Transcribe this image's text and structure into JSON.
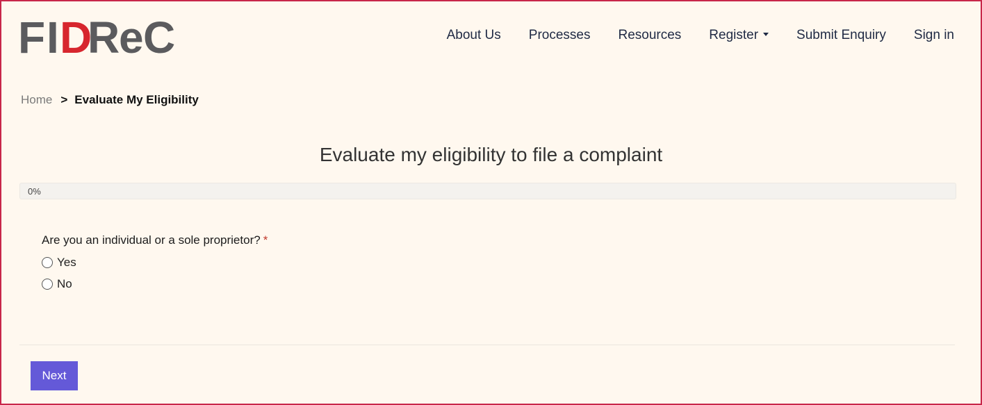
{
  "brand": {
    "logo_text": "FIDReC",
    "colors": {
      "gray": "#5b5b5e",
      "red": "#d7262e",
      "accent": "#6459d8",
      "border": "#c8274a"
    }
  },
  "nav": {
    "items": [
      {
        "label": "About Us"
      },
      {
        "label": "Processes"
      },
      {
        "label": "Resources"
      },
      {
        "label": "Register",
        "dropdown": true
      },
      {
        "label": "Submit Enquiry"
      },
      {
        "label": "Sign in"
      }
    ]
  },
  "breadcrumb": {
    "home": "Home",
    "separator": ">",
    "current": "Evaluate My Eligibility"
  },
  "page": {
    "title": "Evaluate my eligibility to file a complaint"
  },
  "progress": {
    "label": "0%",
    "value": 0
  },
  "question": {
    "text": "Are you an individual or a sole proprietor?",
    "required_marker": "*",
    "options": [
      "Yes",
      "No"
    ]
  },
  "actions": {
    "next_label": "Next"
  }
}
